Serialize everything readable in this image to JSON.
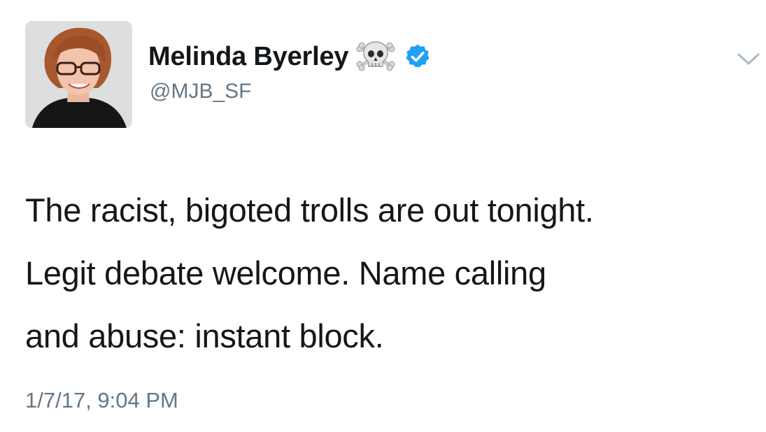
{
  "tweet": {
    "author": {
      "display_name": "Melinda Byerley",
      "handle": "@MJB_SF",
      "name_emoji": "skull-and-crossbones-icon",
      "verified": true
    },
    "text": "The racist, bigoted trolls are out tonight.\nLegit debate welcome. Name calling\nand abuse: instant block.",
    "timestamp": "1/7/17, 9:04 PM"
  },
  "colors": {
    "text_primary": "#14171a",
    "text_secondary": "#657786",
    "verified_blue": "#1da1f2",
    "chevron": "#aab8c2"
  }
}
